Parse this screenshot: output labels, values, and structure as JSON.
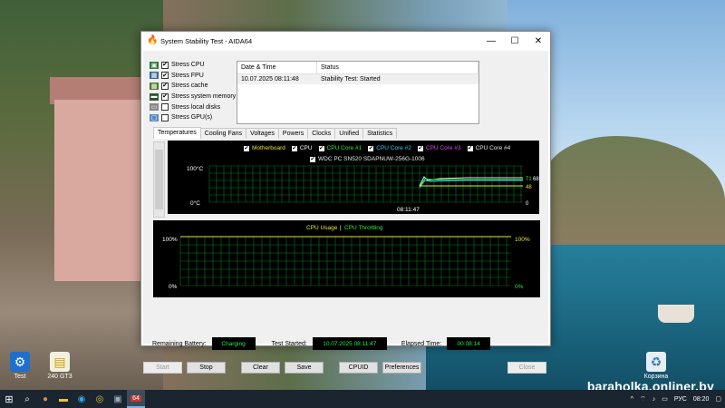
{
  "window": {
    "title": "System Stability Test - AIDA64",
    "minimize": "—",
    "maximize": "☐",
    "close": "✕"
  },
  "stress": {
    "items": [
      {
        "label": "Stress CPU",
        "checked": true,
        "check": "✔"
      },
      {
        "label": "Stress FPU",
        "checked": true,
        "check": "✔"
      },
      {
        "label": "Stress cache",
        "checked": true,
        "check": "✔"
      },
      {
        "label": "Stress system memory",
        "checked": true,
        "check": "✔"
      },
      {
        "label": "Stress local disks",
        "checked": false,
        "check": ""
      },
      {
        "label": "Stress GPU(s)",
        "checked": false,
        "check": ""
      }
    ]
  },
  "log": {
    "headers": [
      "Date & Time",
      "Status"
    ],
    "rows": [
      [
        "10.07.2025 08:11:48",
        "Stability Test: Started"
      ]
    ]
  },
  "tabs": [
    "Temperatures",
    "Cooling Fans",
    "Voltages",
    "Powers",
    "Clocks",
    "Unified",
    "Statistics"
  ],
  "temp_chart": {
    "legend": [
      {
        "name": "Motherboard",
        "color": "#e5e53a"
      },
      {
        "name": "CPU",
        "color": "#ffffff"
      },
      {
        "name": "CPU Core #1",
        "color": "#2ee83a"
      },
      {
        "name": "CPU Core #2",
        "color": "#36c9f0"
      },
      {
        "name": "CPU Core #3",
        "color": "#e046e8"
      },
      {
        "name": "CPU Core #4",
        "color": "#e8e8e8"
      }
    ],
    "legend2": {
      "name": "WDC PC SN520 SDAPNUW-256G-1006",
      "color": "#e8e8e8"
    },
    "y_max_label": "100°C",
    "y_min_label": "0°C",
    "time_label": "08:11:47",
    "right_values": {
      "a": "71",
      "b": "68",
      "c": "48",
      "d": "0"
    }
  },
  "cpu_chart": {
    "legend_usage": "CPU Usage",
    "legend_sep": "|",
    "legend_throttle": "CPU Throttling",
    "left_top": "100%",
    "left_bottom": "0%",
    "right_top": "100%",
    "right_bottom": "0%"
  },
  "status": {
    "battery_label": "Remaining Battery:",
    "battery_value": "Charging",
    "started_label": "Test Started:",
    "started_value": "10.07.2025 08:11:47",
    "elapsed_label": "Elapsed Time:",
    "elapsed_value": "00:08:14"
  },
  "buttons": {
    "start": "Start",
    "stop": "Stop",
    "clear": "Clear",
    "save": "Save",
    "cpuid": "CPUID",
    "preferences": "Preferences",
    "close": "Close"
  },
  "desktop": {
    "icon1": "Test",
    "icon2": "240 GT3",
    "recycle": "Корзина",
    "watermark": "baraholka.onliner.by"
  },
  "taskbar": {
    "app_label": "64",
    "lang": "РУС",
    "time": "08:20"
  },
  "colors": {
    "grid": "#0a7a1a",
    "green_text": "#27e84a",
    "yellow": "#e5e53a"
  }
}
